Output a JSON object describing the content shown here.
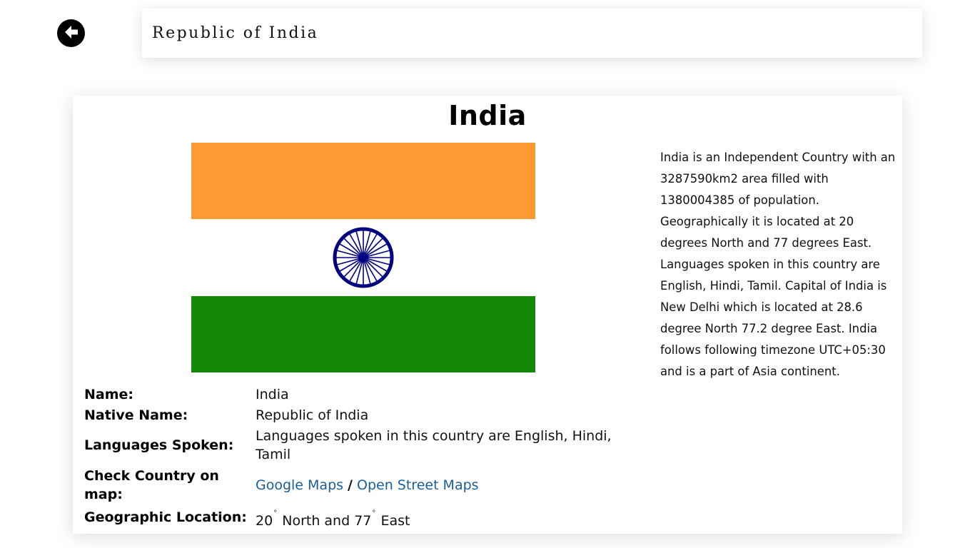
{
  "search": {
    "value": "Republic of India"
  },
  "country": {
    "title": "India",
    "flag_colors": {
      "top": "#FF9933",
      "middle": "#FFFFFF",
      "bottom": "#138808",
      "chakra": "#000080"
    },
    "description": "India is an Independent Country with an 3287590km2 area filled with 1380004385 of population. Geographically it is located at 20 degrees North and 77 degrees East. Languages spoken in this country are English, Hindi, Tamil. Capital of India is New Delhi which is located at 28.6 degree North 77.2 degree East. India follows following timezone UTC+05:30 and is a part of Asia continent."
  },
  "info": {
    "name_label": "Name:",
    "name_value": "India",
    "native_label": "Native Name:",
    "native_value": "Republic of India",
    "languages_label": "Languages Spoken:",
    "languages_value": "Languages spoken in this country are English, Hindi, Tamil",
    "map_label": "Check Country on map:",
    "google_maps_label": "Google Maps",
    "map_separator": "/",
    "osm_label": "Open Street Maps",
    "geo_label": "Geographic Location:",
    "geo_lat": "20",
    "geo_lat_dir": "North and",
    "geo_lon": "77",
    "geo_lon_dir": "East",
    "degree_symbol": "°"
  },
  "icons": {
    "back": "arrow-left-circle-icon"
  }
}
